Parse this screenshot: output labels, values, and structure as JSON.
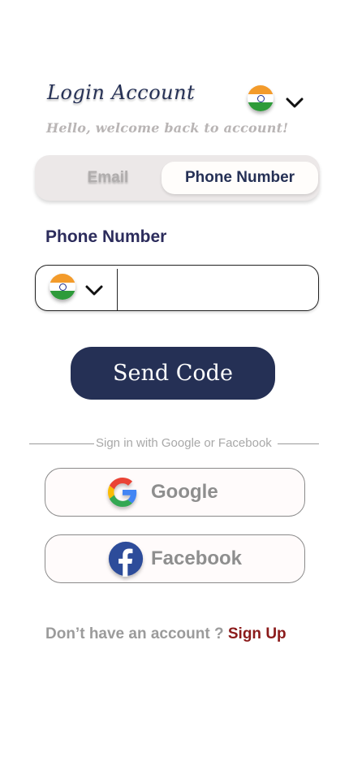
{
  "header": {
    "title": "Login Account",
    "subtitle": "Hello, welcome back to account!",
    "language_flag": "india-flag-icon"
  },
  "tabs": {
    "email_label": "Email",
    "phone_label": "Phone Number",
    "selected": "Phone Number"
  },
  "form": {
    "phone_label": "Phone Number",
    "country_flag": "india-flag-icon",
    "phone_value": "",
    "phone_placeholder": ""
  },
  "actions": {
    "send_code_label": "Send Code"
  },
  "social": {
    "divider_text": "Sign in with Google or Facebook",
    "google_label": "Google",
    "facebook_label": "Facebook"
  },
  "footer": {
    "prompt": "Don’t have an account ?",
    "signup_label": "Sign Up"
  },
  "colors": {
    "primary": "#253055",
    "signup_link": "#8b1a1a",
    "muted": "#9b9b9b"
  }
}
